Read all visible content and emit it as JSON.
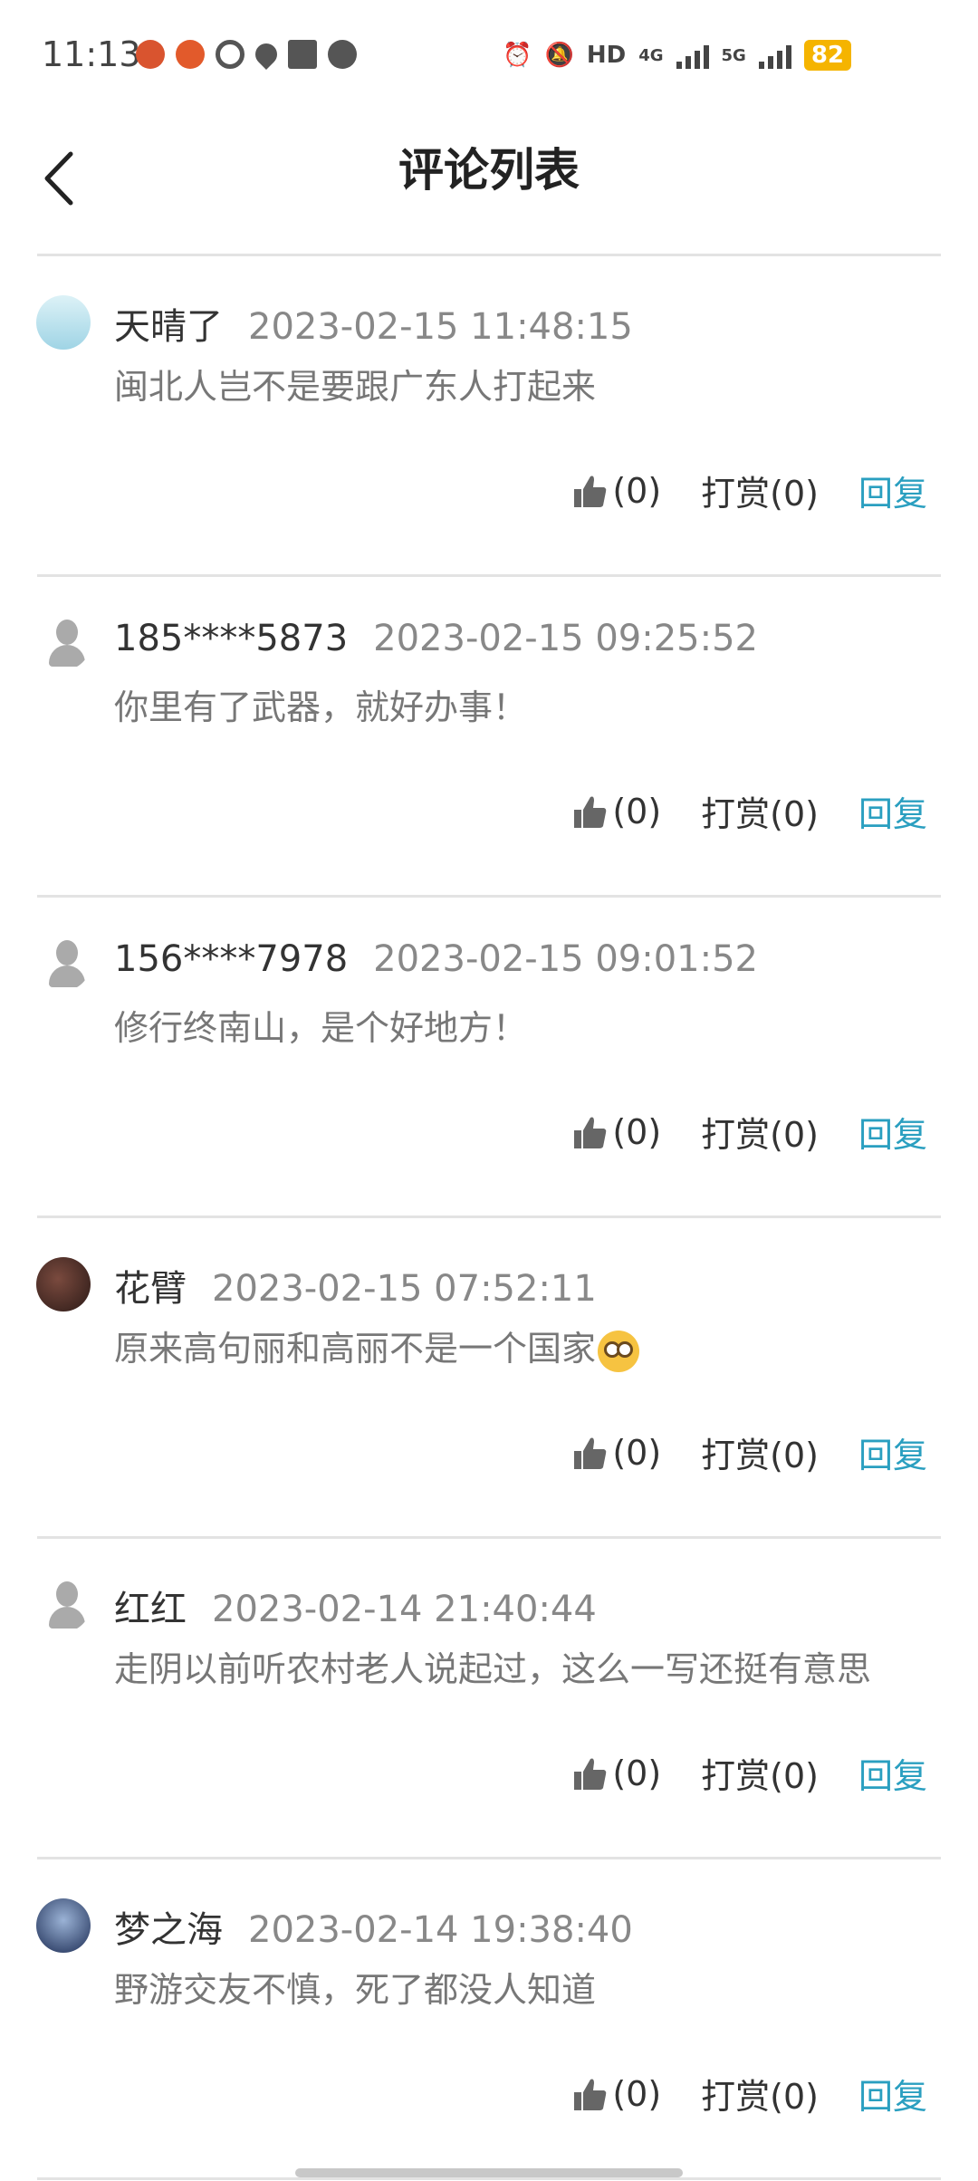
{
  "status": {
    "time": "11:13",
    "battery": "82",
    "hd": "HD",
    "net4g": "4G",
    "net5g": "5G",
    "left_icons": [
      "app-icon",
      "app-icon",
      "q-icon",
      "location-icon",
      "news-icon",
      "chat-icon"
    ]
  },
  "header": {
    "back_icon": "back-arrow-icon",
    "title": "评论列表"
  },
  "colors": {
    "reply": "#2a9fc0",
    "meta_gray": "#888888",
    "battery": "#f5b400"
  },
  "comments": [
    {
      "nick": "天晴了",
      "time": "2023-02-15 11:48:15",
      "content": "闽北人岂不是要跟广东人打起来",
      "likes": "(0)",
      "reward": "打赏(0)",
      "reply": "回复",
      "avatar": "light"
    },
    {
      "nick": "185****5873",
      "time": "2023-02-15 09:25:52",
      "content": "你里有了武器，就好办事！",
      "likes": "(0)",
      "reward": "打赏(0)",
      "reply": "回复",
      "avatar": "default"
    },
    {
      "nick": "156****7978",
      "time": "2023-02-15 09:01:52",
      "content": "修行终南山，是个好地方！",
      "likes": "(0)",
      "reward": "打赏(0)",
      "reply": "回复",
      "avatar": "default"
    },
    {
      "nick": "花臂",
      "time": "2023-02-15 07:52:11",
      "content": "原来高句丽和高丽不是一个国家",
      "likes": "(0)",
      "reward": "打赏(0)",
      "reply": "回复",
      "avatar": "dark",
      "emoji": "flushed-face-icon"
    },
    {
      "nick": "红红",
      "time": "2023-02-14 21:40:44",
      "content": "走阴以前听农村老人说起过，这么一写还挺有意思",
      "likes": "(0)",
      "reward": "打赏(0)",
      "reply": "回复",
      "avatar": "default"
    },
    {
      "nick": "梦之海",
      "time": "2023-02-14 19:38:40",
      "content": "野游交友不慎，死了都没人知道",
      "likes": "(0)",
      "reward": "打赏(0)",
      "reply": "回复",
      "avatar": "sea"
    }
  ]
}
